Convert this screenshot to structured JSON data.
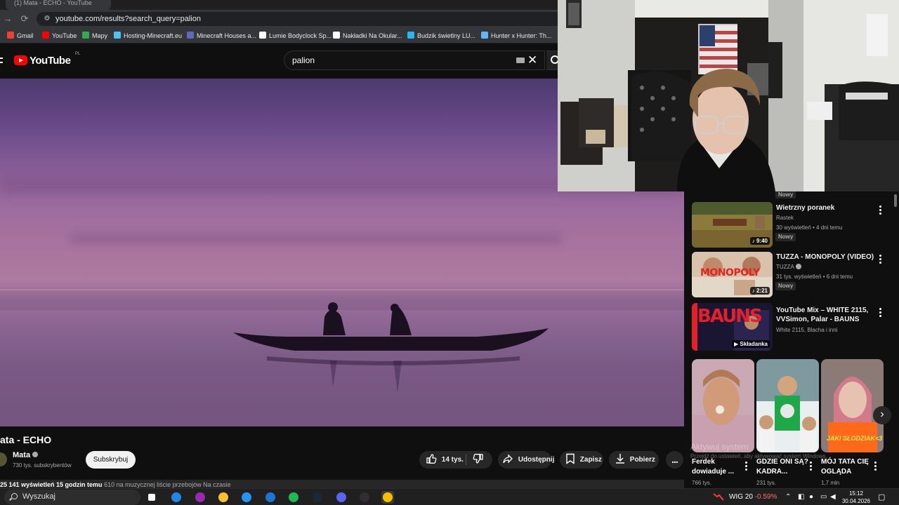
{
  "browser": {
    "tab_title": "(1) Mata - ECHO - YouTube",
    "url": "youtube.com/results?search_query=palion",
    "bookmarks": [
      {
        "label": "Gmail",
        "icon": "gmail-icon",
        "color": "#ea4335"
      },
      {
        "label": "YouTube",
        "icon": "youtube-icon",
        "color": "#ff0000"
      },
      {
        "label": "Mapy",
        "icon": "maps-icon",
        "color": "#34a853"
      },
      {
        "label": "Hosting-Minecraft.eu",
        "icon": "hosting-icon",
        "color": "#4fc3f7"
      },
      {
        "label": "Minecraft Houses a...",
        "icon": "minecraft-icon",
        "color": "#5c6bc0"
      },
      {
        "label": "Lumie Bodyclock Sp...",
        "icon": "amazon-icon",
        "color": "#ffffff"
      },
      {
        "label": "Nakładki Na Okular...",
        "icon": "page-icon",
        "color": "#ffffff"
      },
      {
        "label": "Budzik świetlny LU...",
        "icon": "ceneo-icon",
        "color": "#29b6f6"
      },
      {
        "label": "Hunter x Hunter: Th...",
        "icon": "prime-icon",
        "color": "#64b5f6"
      }
    ]
  },
  "youtube": {
    "logo_text": "YouTube",
    "country_code": "PL",
    "search_query": "palion"
  },
  "video": {
    "title": "ata - ECHO",
    "channel": "Mata",
    "subscribers": "730 tys. subskrybentów",
    "subscribe_label": "Subskrybuj",
    "likes": "14 tys.",
    "share_label": "Udostępnij",
    "save_label": "Zapisz",
    "download_label": "Pobierz",
    "more_label": "...",
    "description_views": "25 141 wyświetleń  15 godzin temu",
    "description_extra": "610 na muzycznej liście przebojów Na czasie"
  },
  "sidebar": {
    "top_badge": "Nowy",
    "items": [
      {
        "title": "Wietrzny poranek",
        "channel": "Rastek",
        "meta": "30 wyświetleń • 4 dni temu",
        "badge": "Nowy",
        "duration": "9:40"
      },
      {
        "title": "TUZZA - MONOPOLY (VIDEO)",
        "channel": "TUZZA",
        "meta": "31 tys. wyświetleń • 6 dni temu",
        "badge": "Nowy",
        "duration": "2:21",
        "thumb_text": "MONOPOLY"
      },
      {
        "title": "YouTube Mix – WHITE 2115, VVSimon, Palar - BAUNS",
        "channel": "White 2115, Blacha i inni",
        "meta": "",
        "badge": "",
        "duration": "Składanka",
        "thumb_text": "BAUNS"
      }
    ],
    "shorts": [
      {
        "title": "Ferdek dowiaduje ...",
        "views": "766 tys."
      },
      {
        "title": "GDZIE ONI SĄ? KADRA...",
        "views": "231 tys."
      },
      {
        "title": "MÓJ TATA CIĘ OGLĄDA",
        "views": "1,7 mln",
        "overlay": "JAKI SŁODZIAK<3"
      }
    ],
    "next_label": "›"
  },
  "windows_watermark": {
    "line1": "Aktywuj system",
    "line2": "Przejdź do ustawień, aby aktywować system Windows."
  },
  "taskbar": {
    "search_placeholder": "Wyszukaj",
    "stock_name": "WIG 20",
    "stock_change": "-0.59%",
    "time": "15:12",
    "date": "30.04.2026",
    "apps": [
      {
        "icon": "taskview-icon",
        "color": "#ffffff"
      },
      {
        "icon": "edge-icon",
        "color": "#1e88e5"
      },
      {
        "icon": "copilot-icon",
        "color": "#9c27b0"
      },
      {
        "icon": "explorer-icon",
        "color": "#fbc02d"
      },
      {
        "icon": "store-icon",
        "color": "#2196f3"
      },
      {
        "icon": "mail-icon",
        "color": "#1976d2"
      },
      {
        "icon": "spotify-icon",
        "color": "#1db954"
      },
      {
        "icon": "steam-icon",
        "color": "#1b2838"
      },
      {
        "icon": "discord-icon",
        "color": "#5865f2"
      },
      {
        "icon": "obs-icon",
        "color": "#302e31"
      },
      {
        "icon": "chrome-icon",
        "color": "#fbbc04"
      }
    ]
  }
}
